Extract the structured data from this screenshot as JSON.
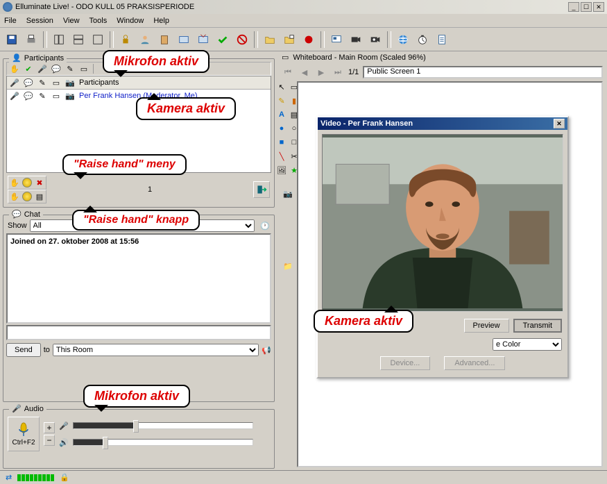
{
  "title": "Elluminate Live! - ODO KULL 05 PRAKSISPERIODE",
  "menu": [
    "File",
    "Session",
    "View",
    "Tools",
    "Window",
    "Help"
  ],
  "annotations": {
    "mic_top": "Mikrofon aktiv",
    "cam_top": "Kamera aktiv",
    "raise_menu": "\"Raise hand\" meny",
    "raise_btn": "\"Raise hand\" knapp",
    "cam_right": "Kamera aktiv",
    "mic_bottom": "Mikrofon aktiv"
  },
  "participants": {
    "title": "Participants",
    "header_label": "Participants",
    "people": [
      {
        "name": "Per Frank Hansen (Moderator, Me)"
      }
    ],
    "count": "1"
  },
  "chat": {
    "title": "Chat",
    "show_label": "Show",
    "filter_options": [
      "All"
    ],
    "filter_value": "All",
    "log": "Joined on 27. oktober 2008 at 15:56",
    "send_label": "Send",
    "to_label": "to",
    "to_value": "This Room",
    "to_options": [
      "This Room"
    ]
  },
  "audio": {
    "title": "Audio",
    "shortcut": "Ctrl+F2",
    "mic_level": 30,
    "spk_level": 15
  },
  "whiteboard": {
    "title": "Whiteboard - Main Room (Scaled 96%)",
    "page": "1/1",
    "screen": "Public Screen 1"
  },
  "video": {
    "title": "Video - Per Frank Hansen",
    "preview": "Preview",
    "transmit": "Transmit",
    "color_label": "e Color",
    "device": "Device...",
    "advanced": "Advanced..."
  }
}
